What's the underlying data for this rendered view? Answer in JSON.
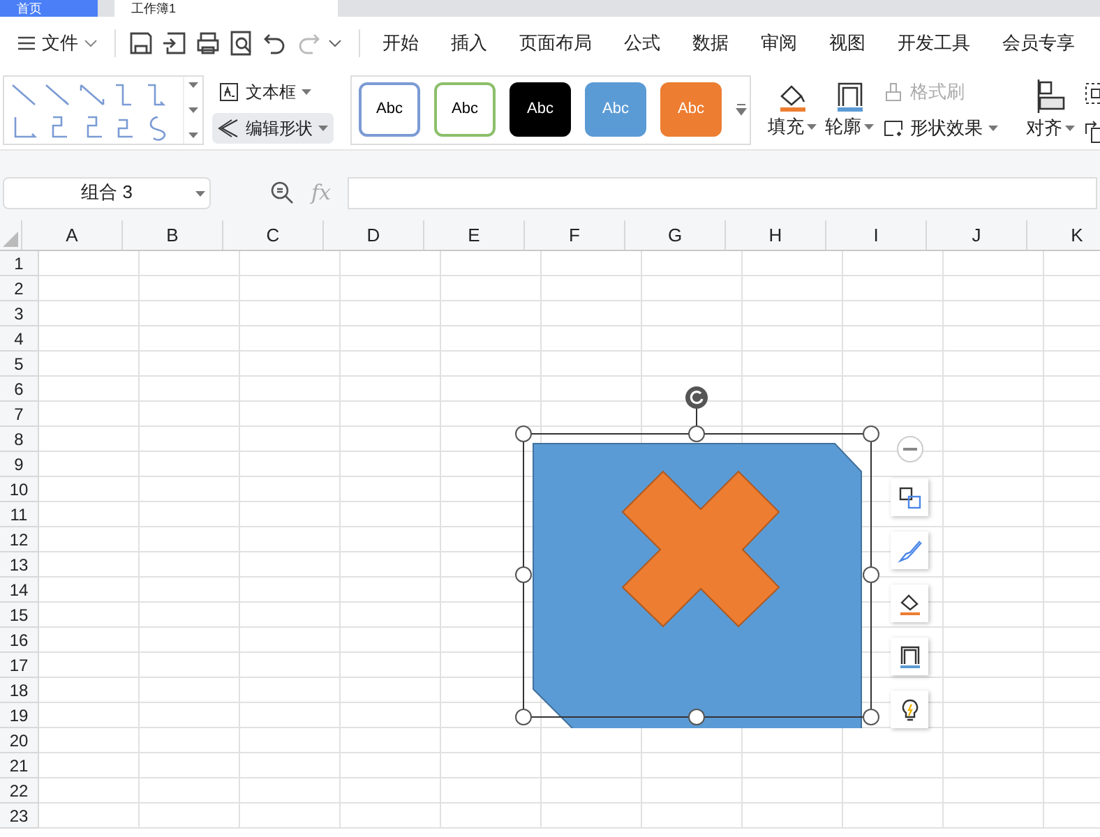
{
  "doc_tabs": [
    {
      "label": "首页",
      "selected": false
    },
    {
      "label": "工作簿1",
      "selected": true
    }
  ],
  "menu": {
    "file": "文件",
    "tabs": [
      {
        "label": "开始",
        "selected": false
      },
      {
        "label": "插入",
        "selected": false
      },
      {
        "label": "页面布局",
        "selected": false
      },
      {
        "label": "公式",
        "selected": false
      },
      {
        "label": "数据",
        "selected": false
      },
      {
        "label": "审阅",
        "selected": false
      },
      {
        "label": "视图",
        "selected": false
      },
      {
        "label": "开发工具",
        "selected": false
      },
      {
        "label": "会员专享",
        "selected": false
      }
    ]
  },
  "ribbon": {
    "text_box": "文本框",
    "edit_shape": "编辑形状",
    "styles": [
      {
        "label": "Abc",
        "kind": "outline",
        "color": "#7b9bd4"
      },
      {
        "label": "Abc",
        "kind": "outline",
        "color": "#8cbf6a"
      },
      {
        "label": "Abc",
        "kind": "filled",
        "color": "#000000"
      },
      {
        "label": "Abc",
        "kind": "filled",
        "color": "#5b9bd5"
      },
      {
        "label": "Abc",
        "kind": "filled",
        "color": "#ed7d31"
      }
    ],
    "fill": "填充",
    "outline": "轮廓",
    "format_painter": {
      "label": "格式刷",
      "disabled": true
    },
    "shape_effects": "形状效果",
    "align": "对齐"
  },
  "formula_bar": {
    "name_box": "组合 3",
    "fx": "fx"
  },
  "sheet": {
    "columns": [
      "A",
      "B",
      "C",
      "D",
      "E",
      "F",
      "G",
      "H",
      "I",
      "J",
      "K"
    ],
    "rows": [
      "1",
      "2",
      "3",
      "4",
      "5",
      "6",
      "7",
      "8",
      "9",
      "10",
      "11",
      "12",
      "13",
      "14",
      "15",
      "16",
      "17",
      "18",
      "19",
      "20",
      "21",
      "22",
      "23"
    ]
  }
}
